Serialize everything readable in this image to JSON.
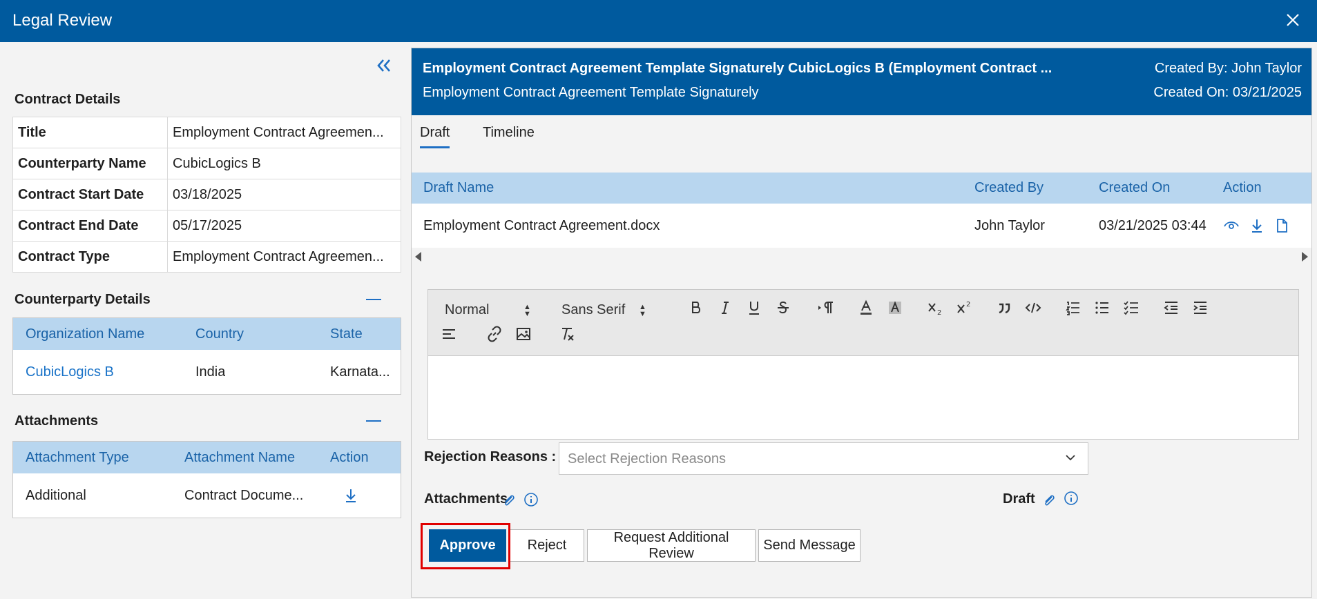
{
  "window": {
    "title": "Legal Review"
  },
  "contract_details": {
    "heading": "Contract Details",
    "rows": [
      {
        "key": "Title",
        "value": "Employment Contract Agreemen..."
      },
      {
        "key": "Counterparty Name",
        "value": "CubicLogics B"
      },
      {
        "key": "Contract Start Date",
        "value": "03/18/2025"
      },
      {
        "key": "Contract End Date",
        "value": "05/17/2025"
      },
      {
        "key": "Contract Type",
        "value": "Employment Contract Agreemen..."
      }
    ]
  },
  "counterparty": {
    "heading": "Counterparty Details",
    "columns": [
      "Organization Name",
      "Country",
      "State"
    ],
    "row": {
      "organization": "CubicLogics B",
      "country": "India",
      "state": "Karnata..."
    }
  },
  "attachments_panel": {
    "heading": "Attachments",
    "columns": [
      "Attachment Type",
      "Attachment Name",
      "Action"
    ],
    "row": {
      "type": "Additional",
      "name": "Contract Docume..."
    }
  },
  "document_header": {
    "title": "Employment Contract Agreement Template Signaturely CubicLogics B (Employment Contract ...",
    "subtitle": "Employment Contract Agreement Template Signaturely",
    "created_by": "Created By: John Taylor",
    "created_on": "Created On: 03/21/2025"
  },
  "tabs": [
    "Draft",
    "Timeline"
  ],
  "drafts_table": {
    "columns": [
      "Draft Name",
      "Created By",
      "Created On",
      "Action"
    ],
    "row": {
      "name": "Employment Contract Agreement.docx",
      "created_by": "John Taylor",
      "created_on": "03/21/2025 03:44"
    }
  },
  "editor": {
    "format": "Normal",
    "font": "Sans Serif"
  },
  "form": {
    "rejection_label": "Rejection Reasons :",
    "rejection_placeholder": "Select Rejection Reasons",
    "attachments_label": "Attachments",
    "draft_label": "Draft"
  },
  "actions": {
    "approve": "Approve",
    "reject": "Reject",
    "request_review": "Request Additional Review",
    "send_message": "Send Message"
  },
  "colors": {
    "primary": "#005a9e",
    "header_row": "#b8d6ef",
    "link": "#1a73c8",
    "highlight": "#e00000"
  }
}
